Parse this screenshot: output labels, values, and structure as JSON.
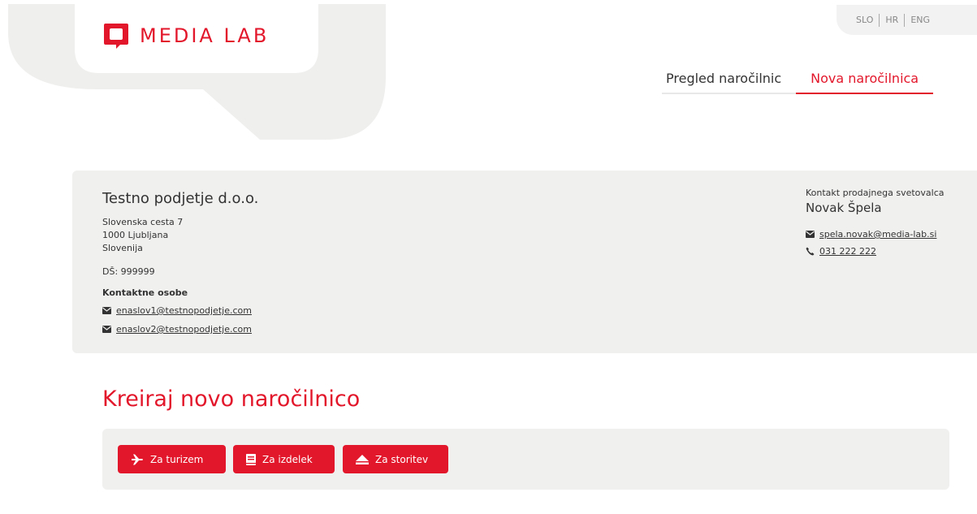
{
  "brand": {
    "name": "MEDIA LAB",
    "accent": "#e3172b"
  },
  "languages": [
    "SLO",
    "HR",
    "ENG"
  ],
  "nav": {
    "items": [
      "Pregled naročilnic",
      "Nova naročilnica"
    ],
    "active": "Nova naročilnica"
  },
  "company": {
    "name": "Testno podjetje d.o.o.",
    "address": [
      "Slovenska cesta 7",
      "1000 Ljubljana",
      "Slovenija"
    ],
    "vat": "DŠ: 999999",
    "contacts_title": "Kontaktne osobe",
    "contacts": [
      "enaslov1@testnopodjetje.com",
      "enaslov2@testnopodjetje.com"
    ]
  },
  "sales": {
    "label": "Kontakt prodajnega svetovalca",
    "name": "Novak Špela",
    "email": "spela.novak@media-lab.si",
    "phone": "031 222 222"
  },
  "create": {
    "title": "Kreiraj novo naročilnico",
    "buttons": [
      {
        "label": "Za turizem",
        "icon": "plane-icon"
      },
      {
        "label": "Za izdelek",
        "icon": "book-icon"
      },
      {
        "label": "Za storitev",
        "icon": "eject-icon"
      }
    ]
  }
}
